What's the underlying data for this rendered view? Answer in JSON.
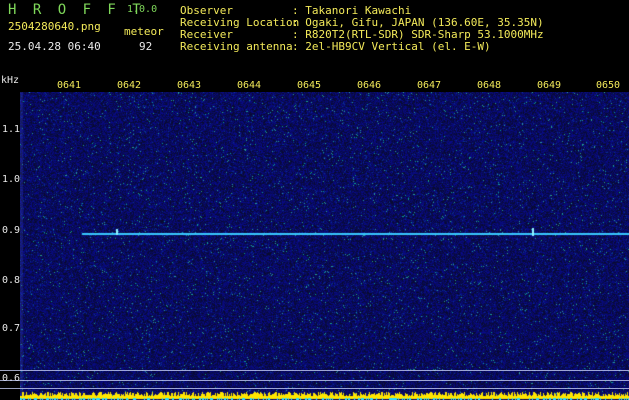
{
  "app": {
    "title": "H R O F F T",
    "version": "1.0.0",
    "filename": "2504280640.png",
    "datetime": "25.04.28 06:40",
    "meteor_label": "meteor",
    "meteor_count": "92"
  },
  "info": {
    "labels": [
      "Observer",
      "Receiving Location",
      "Receiver",
      "Receiving antenna"
    ],
    "values": [
      ": Takanori Kawachi",
      ": Ogaki, Gifu, JAPAN (136.60E, 35.35N)",
      ": R820T2(RTL-SDR) SDR-Sharp 53.1000MHz",
      ": 2el-HB9CV Vertical (el. E-W)"
    ]
  },
  "axis": {
    "y_unit": "kHz",
    "y_ticks": [
      "1.1",
      "1.0",
      "0.9",
      "0.8",
      "0.7",
      "0.6"
    ],
    "x_ticks": [
      "0641",
      "0642",
      "0643",
      "0644",
      "0645",
      "0646",
      "0647",
      "0648",
      "0649",
      "0650"
    ]
  },
  "colors": {
    "background": "#000000",
    "noise": "#1a1f8c",
    "signal": "#36d0ff",
    "trace": "#ffe600",
    "label_green": "#7fd85a",
    "label_yellow": "#f3ea5a"
  }
}
